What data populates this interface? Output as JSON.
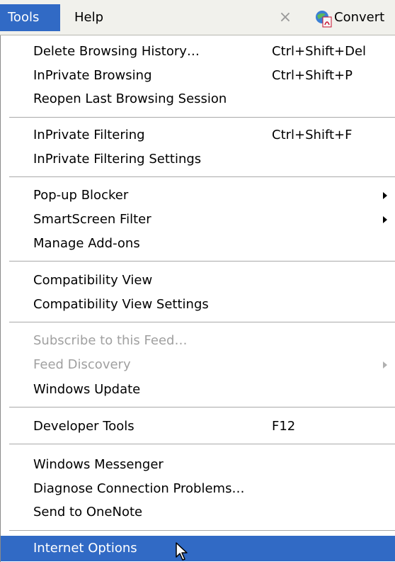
{
  "menubar": {
    "tools": "Tools",
    "help": "Help",
    "close_glyph": "×",
    "convert_label": "Convert"
  },
  "menu": {
    "g1": [
      {
        "label": "Delete Browsing History…",
        "shortcut": "Ctrl+Shift+Del"
      },
      {
        "label": "InPrivate Browsing",
        "shortcut": "Ctrl+Shift+P"
      },
      {
        "label": "Reopen Last Browsing Session"
      }
    ],
    "g2": [
      {
        "label": "InPrivate Filtering",
        "shortcut": "Ctrl+Shift+F"
      },
      {
        "label": "InPrivate Filtering Settings"
      }
    ],
    "g3": [
      {
        "label": "Pop-up Blocker"
      },
      {
        "label": "SmartScreen Filter"
      },
      {
        "label": "Manage Add-ons"
      }
    ],
    "g4": [
      {
        "label": "Compatibility View"
      },
      {
        "label": "Compatibility View Settings"
      }
    ],
    "g5": [
      {
        "label": "Subscribe to this Feed…"
      },
      {
        "label": "Feed Discovery"
      },
      {
        "label": "Windows Update"
      }
    ],
    "g6": [
      {
        "label": "Developer Tools",
        "shortcut": "F12"
      }
    ],
    "g7": [
      {
        "label": "Windows Messenger"
      },
      {
        "label": "Diagnose Connection Problems…"
      },
      {
        "label": "Send to OneNote"
      }
    ],
    "g8": [
      {
        "label": "Internet Options"
      }
    ]
  },
  "icons": {
    "close": "close-icon",
    "convert": "pdf-convert-icon",
    "submenu": "submenu-arrow-icon",
    "cursor": "mouse-pointer-icon"
  },
  "colors": {
    "highlight": "#316ac5",
    "disabled_text": "#a0a0a0",
    "menubar_bg": "#f1f1ec"
  }
}
